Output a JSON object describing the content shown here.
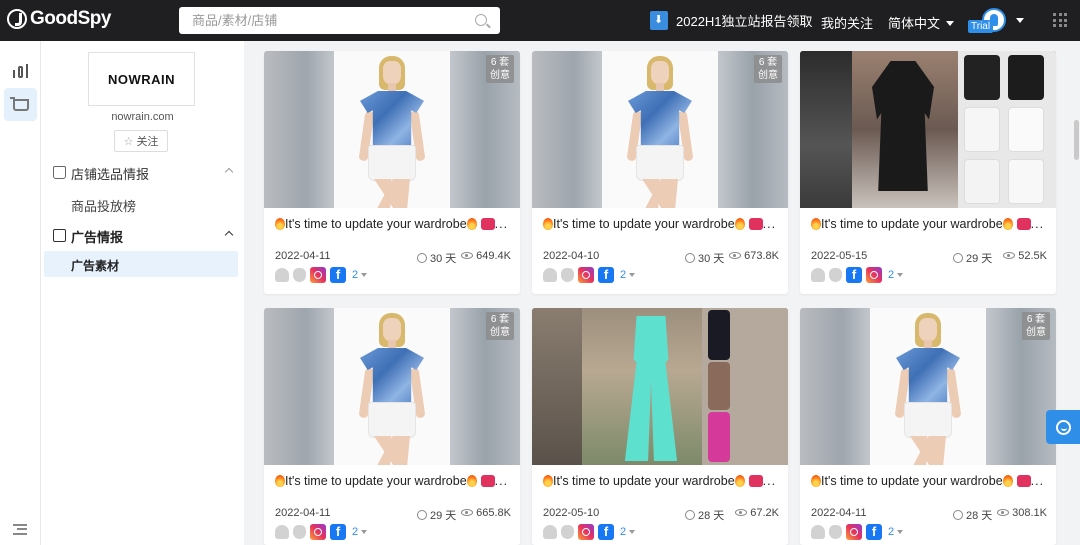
{
  "brand": {
    "name": "GoodSpy"
  },
  "search": {
    "placeholder": "商品/素材/店铺"
  },
  "nav": {
    "report": "2022H1独立站报告领取",
    "follow": "我的关注",
    "language": "简体中文"
  },
  "user": {
    "badge": "Trial"
  },
  "store": {
    "logo_text": "NOWRAIN",
    "domain": "nowrain.com",
    "follow_label": "关注"
  },
  "menu": {
    "group1": "店铺选品情报",
    "group1_sub": "商品投放榜",
    "group2": "广告情报",
    "group2_sub": "广告素材"
  },
  "cards": [
    {
      "badge_top": "6 套",
      "badge_bottom": "创意",
      "title": "It's time to update your wardrobe",
      "date": "2022-04-11",
      "days": "30 天",
      "views": "649.4K",
      "more": "2"
    },
    {
      "badge_top": "6 套",
      "badge_bottom": "创意",
      "title": "It's time to update your wardrobe",
      "date": "2022-04-10",
      "days": "30 天",
      "views": "673.8K",
      "more": "2"
    },
    {
      "title": "It's time to update your wardrobe",
      "date": "2022-05-15",
      "days": "29 天",
      "views": "52.5K",
      "more": "2"
    },
    {
      "badge_top": "6 套",
      "badge_bottom": "创意",
      "title": "It's time to update your wardrobe",
      "date": "2022-04-11",
      "days": "29 天",
      "views": "665.8K",
      "more": "2"
    },
    {
      "title": "It's time to update your wardrobe",
      "date": "2022-05-10",
      "days": "28 天",
      "views": "67.2K",
      "more": "2"
    },
    {
      "badge_top": "6 套",
      "badge_bottom": "创意",
      "title": "It's time to update your wardrobe",
      "date": "2022-04-11",
      "days": "28 天",
      "views": "308.1K",
      "more": "2"
    }
  ]
}
